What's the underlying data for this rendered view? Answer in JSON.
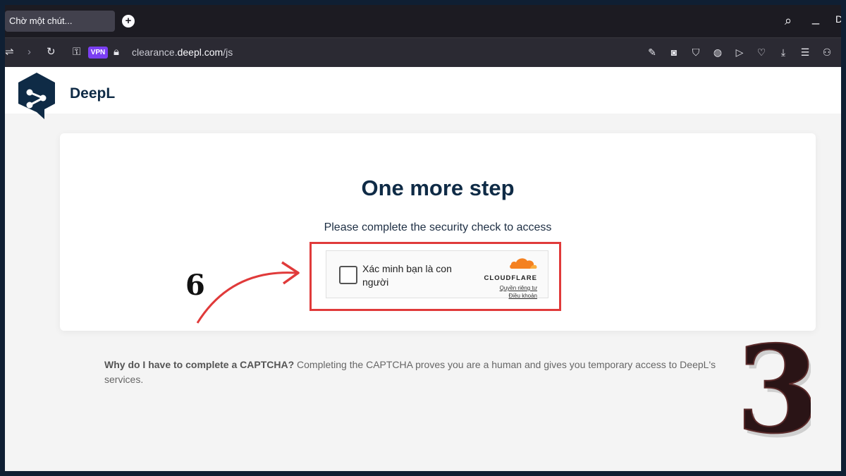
{
  "browser": {
    "tab_title": "Chờ một chút...",
    "new_tab": "+",
    "url_prefix": "clearance.",
    "url_domain": "deepl.com",
    "url_path": "/js",
    "vpn_label": "VPN",
    "window_controls": {
      "search": "⌕",
      "minimize": "_",
      "extra": "D"
    },
    "toolbar_right_icons": [
      "edit-icon",
      "camera-icon",
      "shield-icon",
      "globe-icon",
      "play-icon",
      "heart-icon",
      "download-icon",
      "menu-icon",
      "user-icon"
    ]
  },
  "site": {
    "brand": "DeepL"
  },
  "card": {
    "title": "One more step",
    "subtitle": "Please complete the security check to access",
    "captcha": {
      "label": "Xác minh bạn là con người",
      "provider": "CLOUDFLARE",
      "privacy_link": "Quyền riêng tư",
      "terms_link": "Điều khoản"
    }
  },
  "info": {
    "question": "Why do I have to complete a CAPTCHA?",
    "answer": " Completing the CAPTCHA proves you are a human and gives you temporary access to DeepL's services."
  },
  "annotations": {
    "step_number": "6",
    "big_number": "3"
  },
  "colors": {
    "highlight": "#e03a3a",
    "deepl_navy": "#0f2b46",
    "cloudflare_orange": "#f48120"
  }
}
